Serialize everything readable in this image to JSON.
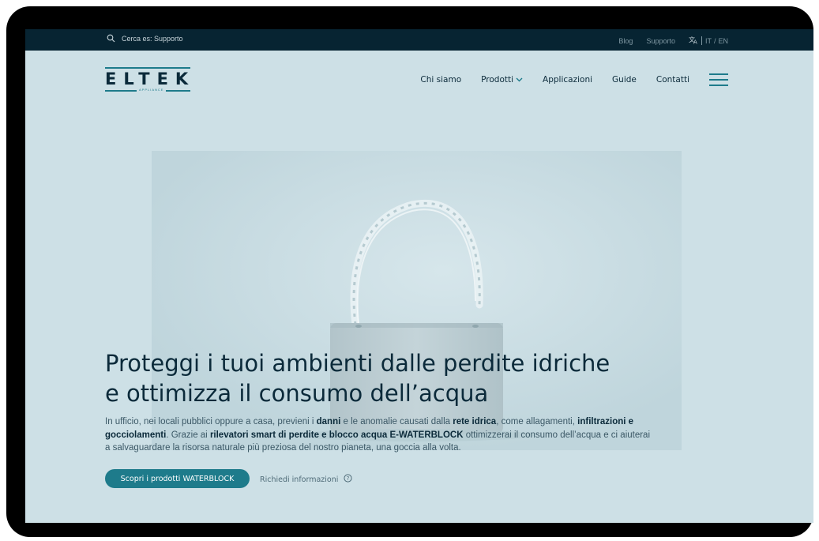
{
  "topbar": {
    "search_placeholder": "Cerca es: Supporto",
    "links": [
      "Blog",
      "Supporto"
    ],
    "lang_it": "IT",
    "lang_sep": "/",
    "lang_en": "EN"
  },
  "header": {
    "logo_text": "ELTEK",
    "logo_subtext": "APPLIANCE",
    "nav": [
      "Chi siamo",
      "Prodotti",
      "Applicazioni",
      "Guide",
      "Contatti"
    ]
  },
  "hero": {
    "title_line1": "Proteggi i tuoi ambienti dalle perdite idriche",
    "title_line2": "e ottimizza il consumo dell’acqua",
    "body": {
      "t1": "In ufficio, nei locali pubblici oppure a casa, previeni i ",
      "b1": "danni",
      "t2": " e le anomalie causati dalla ",
      "b2": "rete idrica",
      "t3": ", come allagamenti, ",
      "b3": "infiltrazioni e gocciolamenti",
      "t4": ". Grazie ai ",
      "b4": "rilevatori smart di perdite e blocco acqua E-WATERBLOCK",
      "t5": " ottimizzerai il consumo dell’acqua e ci aiuterai a salvaguardare la risorsa naturale più preziosa del nostro pianeta, una goccia alla volta."
    },
    "cta_label": "Scopri i prodotti WATERBLOCK",
    "info_label": "Richiedi informazioni"
  },
  "colors": {
    "topbar_bg": "#072432",
    "page_bg": "#cde0e6",
    "accent": "#1e7b8b",
    "text_dark": "#0b2a3a"
  },
  "icons": {
    "search": "search-icon",
    "translate": "translate-icon",
    "chevron": "chevron-down-icon",
    "menu": "hamburger-menu-icon",
    "help": "question-circle-icon"
  }
}
